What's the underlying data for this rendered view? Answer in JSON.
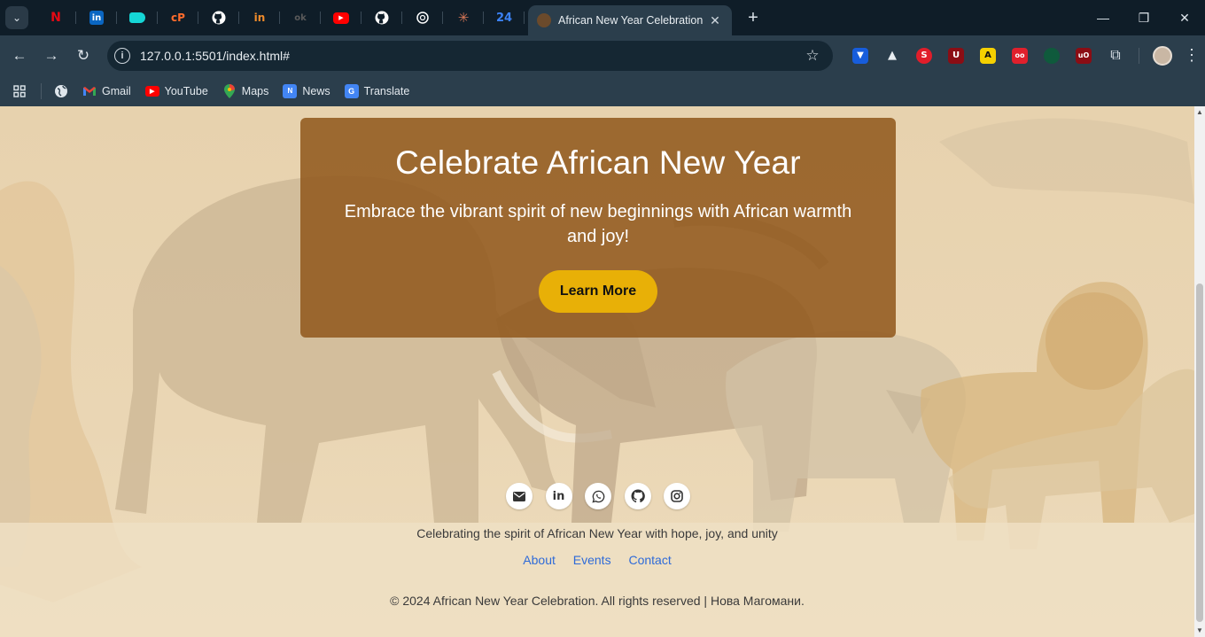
{
  "browser": {
    "pinned_tabs": [
      {
        "icon": "netflix-icon",
        "glyph": "N",
        "color": "#e50914",
        "bg": "transparent"
      },
      {
        "icon": "linkedin-icon",
        "glyph": "in",
        "color": "#ffffff",
        "bg": "#0a66c2"
      },
      {
        "icon": "tag-icon",
        "glyph": "",
        "color": "#ffffff",
        "bg": "#15d6d6"
      },
      {
        "icon": "cpanel-icon",
        "glyph": "cP",
        "color": "#ff6c2c",
        "bg": "transparent"
      },
      {
        "icon": "github-icon",
        "glyph": "",
        "color": "#ffffff",
        "bg": "transparent"
      },
      {
        "icon": "inknoe-icon",
        "glyph": "in",
        "color": "#f08c2b",
        "bg": "transparent"
      },
      {
        "icon": "dark-site-icon",
        "glyph": "ok",
        "color": "#5a5a5a",
        "bg": "transparent"
      },
      {
        "icon": "youtube-icon",
        "glyph": "▶",
        "color": "#ffffff",
        "bg": "#ff0000"
      },
      {
        "icon": "github-icon",
        "glyph": "",
        "color": "#ffffff",
        "bg": "transparent"
      },
      {
        "icon": "chatgpt-icon",
        "glyph": "",
        "color": "#ffffff",
        "bg": "transparent"
      },
      {
        "icon": "claude-icon",
        "glyph": "✳",
        "color": "#d97757",
        "bg": "transparent"
      },
      {
        "icon": "site-24-icon",
        "glyph": "24",
        "color": "#3b82f6",
        "bg": "transparent"
      }
    ],
    "active_tab_title": "African New Year Celebration",
    "url": "127.0.0.1:5501/index.html#",
    "bookmarks": [
      {
        "label": "Gmail",
        "icon": "gmail-icon"
      },
      {
        "label": "YouTube",
        "icon": "youtube-icon"
      },
      {
        "label": "Maps",
        "icon": "maps-icon"
      },
      {
        "label": "News",
        "icon": "news-icon"
      },
      {
        "label": "Translate",
        "icon": "translate-icon"
      }
    ]
  },
  "hero": {
    "title": "Celebrate African New Year",
    "subtitle": "Embrace the vibrant spirit of new beginnings with African warmth and joy!",
    "button": "Learn More"
  },
  "footer": {
    "social_icons": [
      "envelope-icon",
      "linkedin-icon",
      "whatsapp-icon",
      "github-icon",
      "instagram-icon"
    ],
    "tagline": "Celebrating the spirit of African New Year with hope, joy, and unity",
    "links": [
      "About",
      "Events",
      "Contact"
    ],
    "copyright": "© 2024 African New Year Celebration. All rights reserved | Нова Магомани."
  },
  "colors": {
    "hero_card": "#925a1f",
    "button": "#e8b007",
    "link": "#2f6bd8",
    "page_bg": "#ead7b6"
  }
}
